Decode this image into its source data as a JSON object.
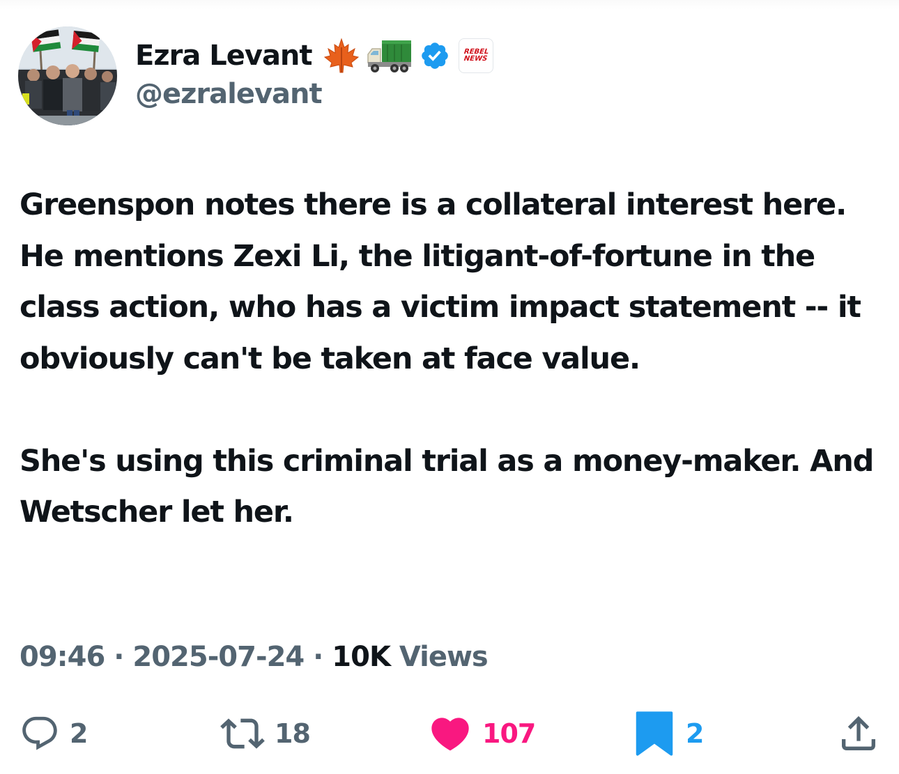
{
  "author": {
    "display_name": "Ezra Levant",
    "handle": "@ezralevant",
    "icons": [
      "maple-leaf-icon",
      "truck-icon",
      "verified-badge-icon",
      "rebel-news-affiliate-icon"
    ],
    "affiliate_label": "REBEL NEWS"
  },
  "tweet": {
    "paragraph_1": "Greenspon notes there is a collateral interest here. He mentions Zexi Li, the litigant-of-fortune in the class action, who has a victim impact statement -- it obviously can't be taken at face value.",
    "paragraph_2": "She's using this criminal trial as a money-maker. And Wetscher let her."
  },
  "meta": {
    "time": "09:46",
    "date": "2025-07-24",
    "separator": " · ",
    "views_count": "10K",
    "views_label": " Views"
  },
  "actions": {
    "replies": "2",
    "reposts": "18",
    "likes": "107",
    "bookmarks": "2"
  },
  "colors": {
    "text": "#0f1419",
    "secondary": "#536471",
    "like": "#f91880",
    "bookmark": "#1d9bf0",
    "verified": "#1d9bf0"
  }
}
